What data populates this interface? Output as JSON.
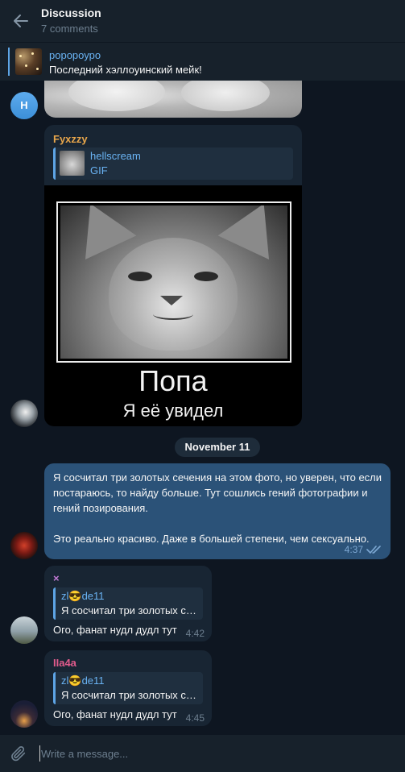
{
  "header": {
    "title": "Discussion",
    "subtitle": "7 comments"
  },
  "pinned": {
    "name": "роророуро",
    "text": "Последний хэллоуинский мейк!"
  },
  "avatars": {
    "h_letter": "H"
  },
  "gif_message": {
    "author": "Fyxzzy",
    "reply_name": "hellscream",
    "reply_type": "GIF",
    "gif_title": "Попа",
    "gif_caption": "Я её увидел"
  },
  "date_separator": "November 11",
  "outgoing": {
    "text": "Я сосчитал три золотых сечения на этом фото, но уверен, что если постараюсь, то найду больше. Тут сошлись гений фотографии и гений позирования.\n\nЭто реально красиво. Даже в большей степени, чем сексуально.",
    "time": "4:37"
  },
  "replies": [
    {
      "author": "×",
      "quote_name": "zl😎de11",
      "quote_text": "Я сосчитал три золотых сечения на этом фото",
      "text": "Ого, фанат нудл дудл тут",
      "time": "4:42"
    },
    {
      "author": "IIa4a",
      "quote_name": "zl😎de11",
      "quote_text": "Я сосчитал три золотых сечения на этом фото",
      "text": "Ого, фанат нудл дудл тут",
      "time": "4:45"
    }
  ],
  "composer": {
    "placeholder": "Write a message..."
  },
  "colors": {
    "background": "#0e1621",
    "panel": "#17212b",
    "bubble_in": "#182533",
    "bubble_out": "#2b5278",
    "accent": "#6ab3f3",
    "author_gif": "#e8a64b",
    "author_reply1": "#c27ad6",
    "author_reply2": "#e05b8c"
  },
  "icons": [
    "back-arrow-icon",
    "double-check-icon",
    "paperclip-icon"
  ]
}
